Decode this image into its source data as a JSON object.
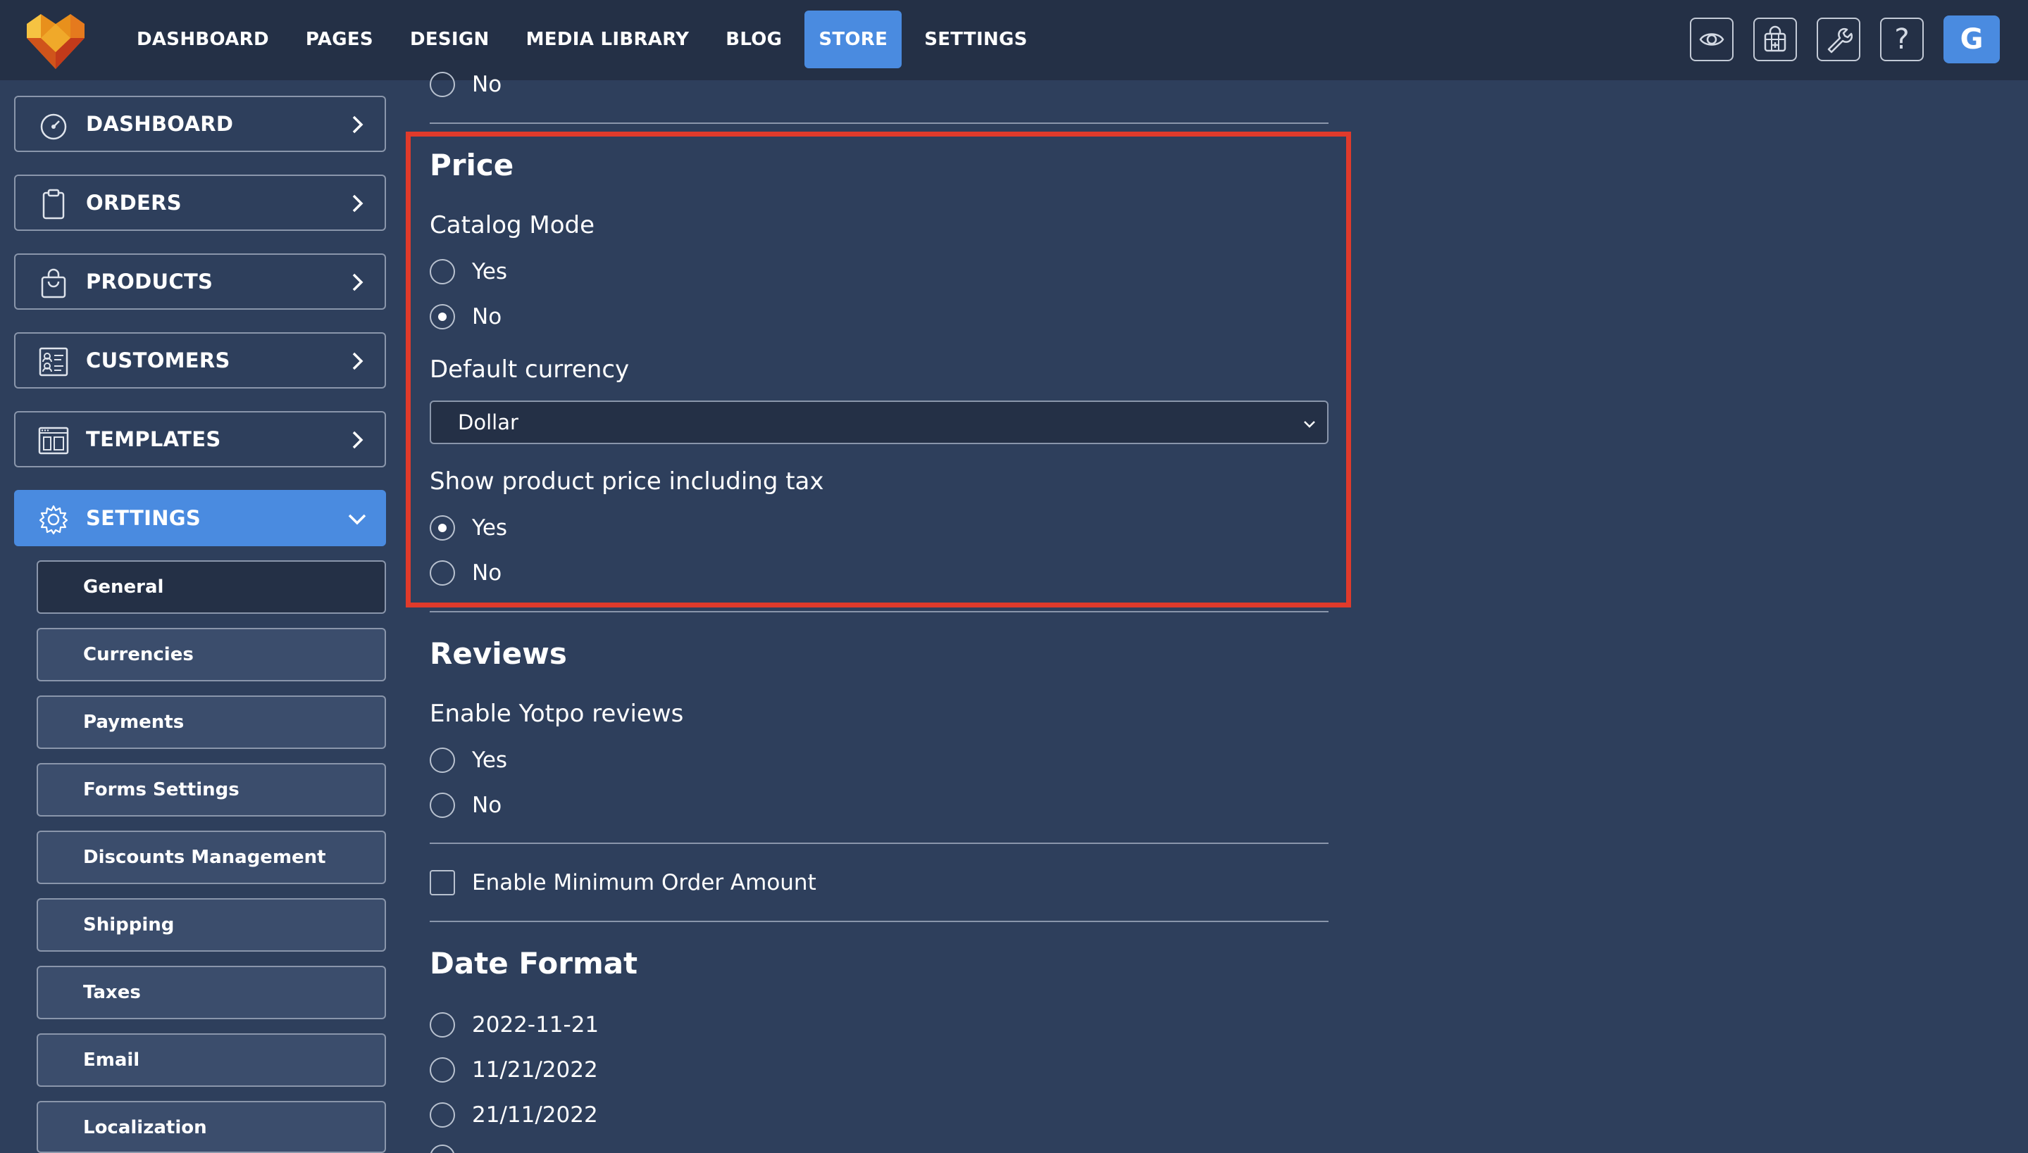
{
  "topnav": {
    "items": [
      "DASHBOARD",
      "PAGES",
      "DESIGN",
      "MEDIA LIBRARY",
      "BLOG",
      "STORE",
      "SETTINGS"
    ],
    "active": "STORE"
  },
  "toolbar": {
    "icons": [
      "eye-icon",
      "store-icon",
      "wrench-icon",
      "help-icon"
    ],
    "help_label": "?",
    "avatar_initial": "G"
  },
  "sidebar": {
    "items": [
      {
        "label": "DASHBOARD",
        "icon": "gauge-icon"
      },
      {
        "label": "ORDERS",
        "icon": "clipboard-icon"
      },
      {
        "label": "PRODUCTS",
        "icon": "bag-icon"
      },
      {
        "label": "CUSTOMERS",
        "icon": "contacts-icon"
      },
      {
        "label": "TEMPLATES",
        "icon": "layout-icon"
      },
      {
        "label": "SETTINGS",
        "icon": "gear-icon"
      }
    ],
    "sub_items": [
      "General",
      "Currencies",
      "Payments",
      "Forms Settings",
      "Discounts Management",
      "Shipping",
      "Taxes",
      "Email",
      "Localization"
    ],
    "active_sub": "General"
  },
  "main": {
    "top_radio_label": "No",
    "price": {
      "title": "Price",
      "catalog_mode": {
        "label": "Catalog Mode",
        "options": [
          "Yes",
          "No"
        ],
        "selected": "No"
      },
      "default_currency": {
        "label": "Default currency",
        "value": "Dollar"
      },
      "show_price_tax": {
        "label": "Show product price including tax",
        "options": [
          "Yes",
          "No"
        ],
        "selected": "Yes"
      }
    },
    "reviews": {
      "title": "Reviews",
      "yotpo": {
        "label": "Enable Yotpo reviews",
        "options": [
          "Yes",
          "No"
        ],
        "selected": ""
      }
    },
    "min_order": {
      "label": "Enable Minimum Order Amount",
      "checked": false
    },
    "date_format": {
      "title": "Date Format",
      "options": [
        "2022-11-21",
        "11/21/2022",
        "21/11/2022"
      ]
    }
  },
  "colors": {
    "background": "#2e3f5c",
    "topbar": "#243046",
    "accent": "#4a8be0",
    "highlight": "#e03a2b"
  }
}
